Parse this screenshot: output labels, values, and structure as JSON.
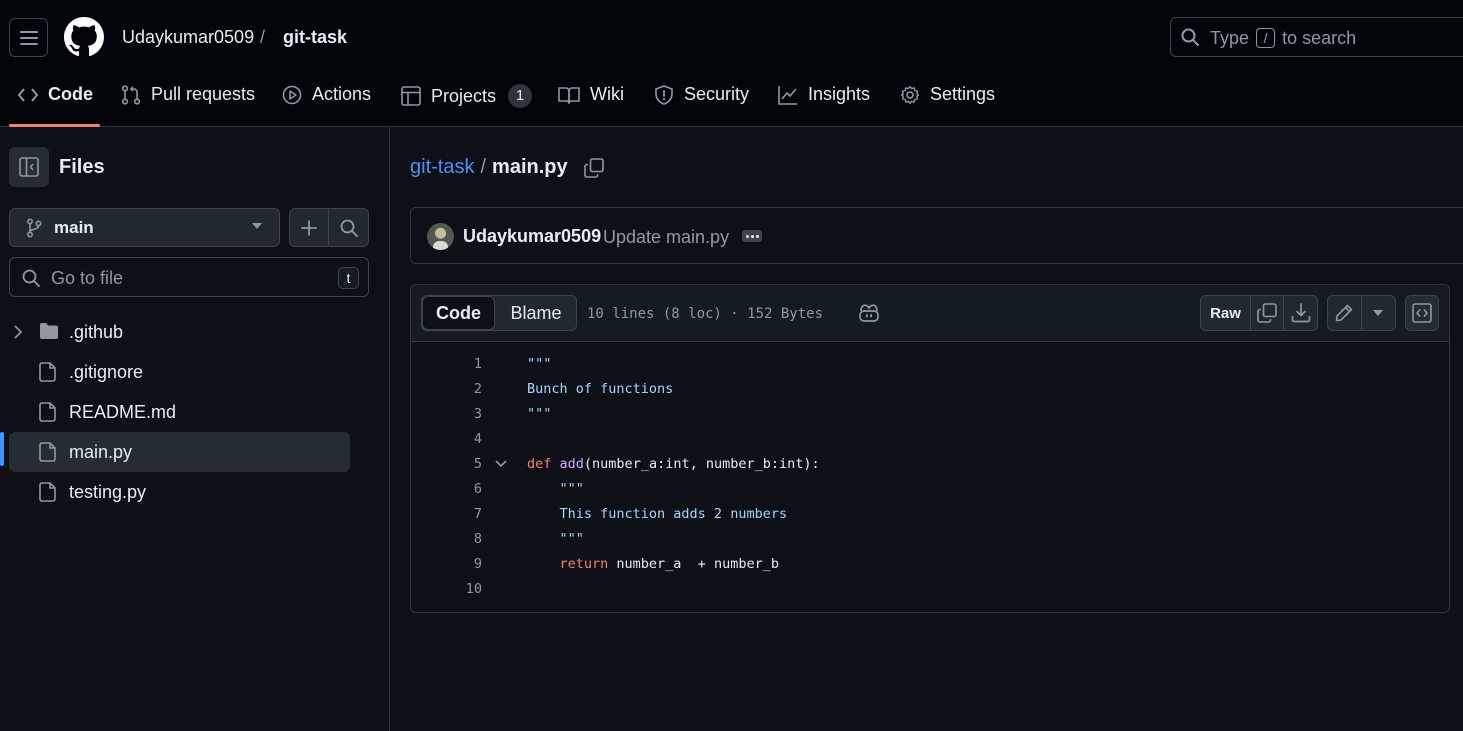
{
  "header": {
    "owner": "Udaykumar0509",
    "separator": "/",
    "repo": "git-task",
    "search": {
      "before": "Type",
      "key": "/",
      "after": "to search"
    }
  },
  "tabs": [
    {
      "label": "Code",
      "icon": "code-icon",
      "active": true
    },
    {
      "label": "Pull requests",
      "icon": "git-pull-request-icon"
    },
    {
      "label": "Actions",
      "icon": "play-icon"
    },
    {
      "label": "Projects",
      "icon": "table-icon",
      "counter": "1"
    },
    {
      "label": "Wiki",
      "icon": "book-icon"
    },
    {
      "label": "Security",
      "icon": "shield-icon"
    },
    {
      "label": "Insights",
      "icon": "graph-icon"
    },
    {
      "label": "Settings",
      "icon": "gear-icon"
    }
  ],
  "sidebar": {
    "title": "Files",
    "branch": "main",
    "goto_placeholder": "Go to file",
    "goto_key": "t",
    "items": [
      {
        "label": ".github",
        "type": "folder"
      },
      {
        "label": ".gitignore",
        "type": "file"
      },
      {
        "label": "README.md",
        "type": "file"
      },
      {
        "label": "main.py",
        "type": "file",
        "selected": true
      },
      {
        "label": "testing.py",
        "type": "file"
      }
    ]
  },
  "breadcrumb": {
    "repo": "git-task",
    "sep": "/",
    "file": "main.py"
  },
  "commit": {
    "author": "Udaykumar0509",
    "message": "Update main.py"
  },
  "file": {
    "view_code": "Code",
    "view_blame": "Blame",
    "meta": "10 lines (8 loc) · 152 Bytes",
    "raw_label": "Raw",
    "lines": [
      {
        "n": "1",
        "text": "\"\"\""
      },
      {
        "n": "2",
        "text": "Bunch of functions"
      },
      {
        "n": "3",
        "text": "\"\"\""
      },
      {
        "n": "4",
        "text": ""
      },
      {
        "n": "5",
        "kw": "def",
        "fn": "add",
        "rest": "(number_a:int, number_b:int):"
      },
      {
        "n": "6",
        "text": "    \"\"\""
      },
      {
        "n": "7",
        "text": "    This function adds 2 numbers"
      },
      {
        "n": "8",
        "text": "    \"\"\""
      },
      {
        "n": "9",
        "kw": "    return",
        "rest": " number_a  + number_b"
      },
      {
        "n": "10",
        "text": ""
      }
    ]
  },
  "colors": {
    "background": "#0d1117",
    "header_bg": "#010409",
    "accent_underline": "#f78166",
    "link": "#4493f8",
    "string": "#a5d6ff",
    "keyword": "#ff7b72",
    "function": "#d2a8ff"
  }
}
